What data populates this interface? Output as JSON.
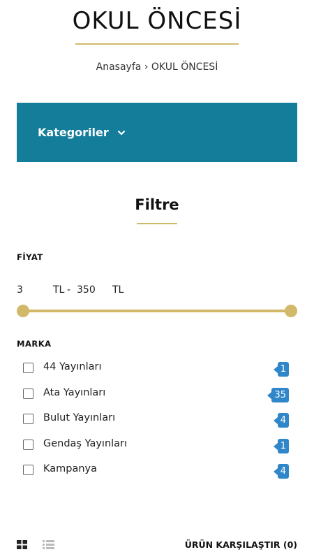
{
  "header": {
    "title": "OKUL ÖNCESİ",
    "breadcrumb": {
      "home": "Anasayfa",
      "separator": "›",
      "current": "OKUL ÖNCESİ"
    }
  },
  "categories": {
    "label": "Kategoriler",
    "icon": "chevron-down-icon"
  },
  "filter": {
    "title": "Filtre",
    "price": {
      "label": "FİYAT",
      "min": "3",
      "currency": "TL",
      "separator": "-",
      "max": "350",
      "range_fraction": [
        0,
        1
      ]
    },
    "brand": {
      "label": "MARKA",
      "items": [
        {
          "name": "44 Yayınları",
          "count": "1",
          "checked": false
        },
        {
          "name": "Ata Yayınları",
          "count": "35",
          "checked": false
        },
        {
          "name": "Bulut Yayınları",
          "count": "4",
          "checked": false
        },
        {
          "name": "Gendaş Yayınları",
          "count": "1",
          "checked": false
        },
        {
          "name": "Kampanya",
          "count": "4",
          "checked": false
        },
        {
          "name": "",
          "count": "",
          "checked": false
        }
      ]
    }
  },
  "toolbar": {
    "grid_view_icon": "grid-view-icon",
    "list_view_icon": "list-view-icon",
    "compare_label": "ÜRÜN KARŞILAŞTIR (0)"
  },
  "colors": {
    "accent_gold": "#d2b96a",
    "category_bar": "#147d9a",
    "count_badge": "#2f86c9"
  }
}
